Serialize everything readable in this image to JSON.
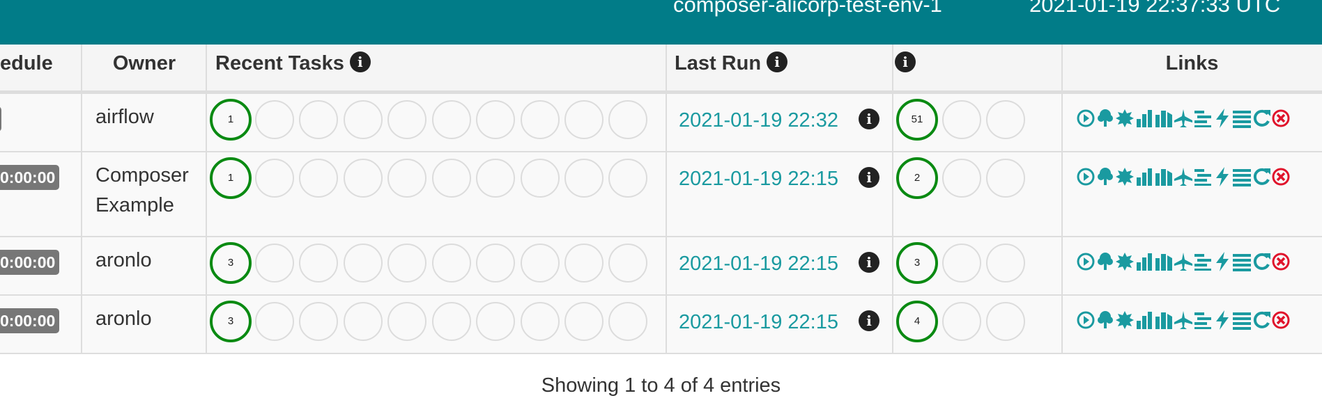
{
  "header": {
    "environment": "composer-alicorp-test-env-1",
    "clock": "2021-01-19 22:37:33 UTC"
  },
  "table": {
    "columns": {
      "schedule": "edule",
      "owner": "Owner",
      "recent_tasks": "Recent Tasks",
      "last_run": "Last Run",
      "dag_runs": "",
      "links": "Links"
    },
    "rows": [
      {
        "schedule": "",
        "owner": "airflow",
        "recent_task_count": "1",
        "last_run": "2021-01-19 22:32",
        "dag_run_count": "51"
      },
      {
        "schedule": "0:00:00",
        "owner": "Composer Example",
        "recent_task_count": "1",
        "last_run": "2021-01-19 22:15",
        "dag_run_count": "2"
      },
      {
        "schedule": "0:00:00",
        "owner": "aronlo",
        "recent_task_count": "3",
        "last_run": "2021-01-19 22:15",
        "dag_run_count": "3"
      },
      {
        "schedule": "0:00:00",
        "owner": "aronlo",
        "recent_task_count": "3",
        "last_run": "2021-01-19 22:15",
        "dag_run_count": "4"
      }
    ]
  },
  "icons": {
    "info": "info-circle-icon",
    "links": [
      "trigger-dag-icon",
      "tree-view-icon",
      "graph-view-icon",
      "tries-chart-icon",
      "duration-chart-icon",
      "landing-times-icon",
      "gantt-icon",
      "code-icon",
      "logs-icon",
      "refresh-icon",
      "delete-icon"
    ]
  },
  "colors": {
    "topbar": "#017c88",
    "success": "#0a8a12",
    "link": "#1a9aa0",
    "delete": "#e0142c"
  },
  "footer": {
    "entries_text": "Showing 1 to 4 of 4 entries"
  }
}
